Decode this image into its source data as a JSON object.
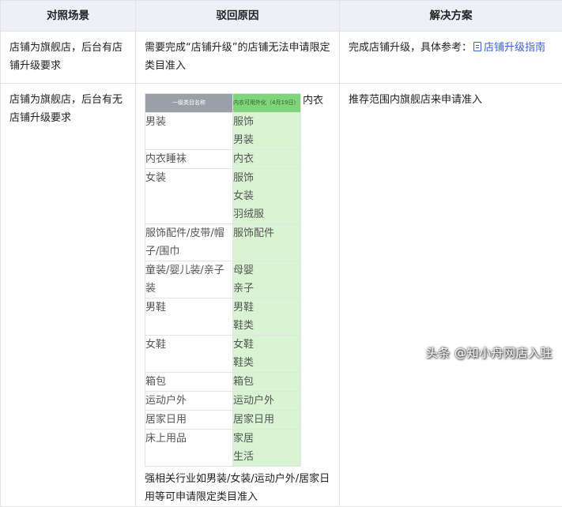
{
  "headers": [
    "对照场景",
    "驳回原因",
    "解决方案"
  ],
  "row1": {
    "scene": "店铺为旗舰店，后台有店铺升级要求",
    "reason": "需要完成“店铺升级”的店铺无法申请限定类目准入",
    "solution_prefix": "完成店铺升级，具体参考：",
    "solution_link": "店铺升级指南"
  },
  "row2": {
    "scene": "店铺为旗舰店，后台有无店铺升级要求",
    "reason_inline_suffix": "内衣",
    "reason_after": "强相关行业如男装/女装/运动户外/居家日用等可申请限定类目准入",
    "solution": "推荐范围内旗舰店来申请准入"
  },
  "category_table": {
    "header_left": "一级类目名称",
    "header_right": "内衣可用外化（4月19日）",
    "rows": [
      {
        "left": "男装",
        "right": [
          "服饰",
          "男装"
        ]
      },
      {
        "left": "内衣睡袜",
        "right": [
          "内衣"
        ]
      },
      {
        "left": "女装",
        "right": [
          "服饰",
          "女装",
          "羽绒服"
        ]
      },
      {
        "left": "服饰配件/皮带/帽子/围巾",
        "right": [
          "服饰配件"
        ]
      },
      {
        "left": "童装/婴儿装/亲子装",
        "right": [
          "母婴",
          "亲子"
        ]
      },
      {
        "left": "男鞋",
        "right": [
          "男鞋",
          "鞋类"
        ]
      },
      {
        "left": "女鞋",
        "right": [
          "女鞋",
          "鞋类"
        ]
      },
      {
        "left": "箱包",
        "right": [
          "箱包"
        ]
      },
      {
        "left": "运动户外",
        "right": [
          "运动户外"
        ]
      },
      {
        "left": "居家日用",
        "right": [
          "居家日用"
        ]
      },
      {
        "left": "床上用品",
        "right": [
          "家居",
          "生活"
        ]
      }
    ]
  },
  "watermark": "头条 @知小舟网店入驻"
}
